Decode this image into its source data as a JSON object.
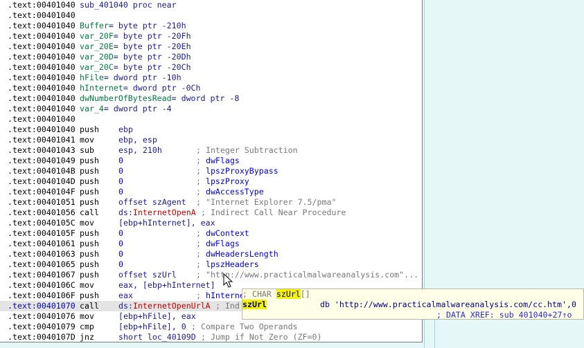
{
  "lines": [
    {
      "addr": ".text:00401040",
      "decl": [
        {
          "t": "sub_401040 proc near",
          "c": "navy"
        }
      ]
    },
    {
      "addr": ".text:00401040",
      "decl": []
    },
    {
      "addr": ".text:00401040",
      "decl": [
        {
          "t": "Buffer",
          "c": "grn"
        },
        {
          "t": "= byte ptr -210h",
          "c": "navy"
        }
      ]
    },
    {
      "addr": ".text:00401040",
      "decl": [
        {
          "t": "var_20F",
          "c": "grn"
        },
        {
          "t": "= byte ptr -20Fh",
          "c": "navy"
        }
      ]
    },
    {
      "addr": ".text:00401040",
      "decl": [
        {
          "t": "var_20E",
          "c": "grn"
        },
        {
          "t": "= byte ptr -20Eh",
          "c": "navy"
        }
      ]
    },
    {
      "addr": ".text:00401040",
      "decl": [
        {
          "t": "var_20D",
          "c": "grn"
        },
        {
          "t": "= byte ptr -20Dh",
          "c": "navy"
        }
      ]
    },
    {
      "addr": ".text:00401040",
      "decl": [
        {
          "t": "var_20C",
          "c": "grn"
        },
        {
          "t": "= byte ptr -20Ch",
          "c": "navy"
        }
      ]
    },
    {
      "addr": ".text:00401040",
      "decl": [
        {
          "t": "hFile",
          "c": "grn"
        },
        {
          "t": "= dword ptr -10h",
          "c": "navy"
        }
      ]
    },
    {
      "addr": ".text:00401040",
      "decl": [
        {
          "t": "hInternet",
          "c": "grn"
        },
        {
          "t": "= dword ptr -0Ch",
          "c": "navy"
        }
      ]
    },
    {
      "addr": ".text:00401040",
      "decl": [
        {
          "t": "dwNumberOfBytesRead",
          "c": "grn"
        },
        {
          "t": "= dword ptr -8",
          "c": "navy"
        }
      ]
    },
    {
      "addr": ".text:00401040",
      "decl": [
        {
          "t": "var_4",
          "c": "grn"
        },
        {
          "t": "= dword ptr -4",
          "c": "navy"
        }
      ]
    },
    {
      "addr": ".text:00401040",
      "decl": []
    },
    {
      "addr": ".text:00401040",
      "mn": "push",
      "op": [
        {
          "t": "ebp",
          "c": "navy"
        }
      ]
    },
    {
      "addr": ".text:00401041",
      "mn": "mov",
      "op": [
        {
          "t": "ebp, esp",
          "c": "navy"
        }
      ]
    },
    {
      "addr": ".text:00401043",
      "mn": "sub",
      "op": [
        {
          "t": "esp, 210h",
          "c": "navy"
        }
      ],
      "cmt": "; Integer Subtraction"
    },
    {
      "addr": ".text:00401049",
      "mn": "push",
      "op": [
        {
          "t": "0",
          "c": "blue"
        }
      ],
      "cmt": "; ",
      "cmtarg": "dwFlags"
    },
    {
      "addr": ".text:0040104B",
      "mn": "push",
      "op": [
        {
          "t": "0",
          "c": "blue"
        }
      ],
      "cmt": "; ",
      "cmtarg": "lpszProxyBypass"
    },
    {
      "addr": ".text:0040104D",
      "mn": "push",
      "op": [
        {
          "t": "0",
          "c": "blue"
        }
      ],
      "cmt": "; ",
      "cmtarg": "lpszProxy"
    },
    {
      "addr": ".text:0040104F",
      "mn": "push",
      "op": [
        {
          "t": "0",
          "c": "blue"
        }
      ],
      "cmt": "; ",
      "cmtarg": "dwAccessType"
    },
    {
      "addr": ".text:00401051",
      "mn": "push",
      "op": [
        {
          "t": "offset szAgent",
          "c": "navy"
        }
      ],
      "cmt": "; \"Internet Explorer 7.5/pma\""
    },
    {
      "addr": ".text:00401056",
      "mn": "call",
      "op": [
        {
          "t": "ds:",
          "c": "navy"
        },
        {
          "t": "InternetOpenA",
          "c": "fn"
        }
      ],
      "cmt": " ; Indirect Call Near Procedure"
    },
    {
      "addr": ".text:0040105C",
      "mn": "mov",
      "op": [
        {
          "t": "[ebp+hInternet], eax",
          "c": "navy"
        }
      ]
    },
    {
      "addr": ".text:0040105F",
      "mn": "push",
      "op": [
        {
          "t": "0",
          "c": "blue"
        }
      ],
      "cmt": "; ",
      "cmtarg": "dwContext"
    },
    {
      "addr": ".text:00401061",
      "mn": "push",
      "op": [
        {
          "t": "0",
          "c": "blue"
        }
      ],
      "cmt": "; ",
      "cmtarg": "dwFlags"
    },
    {
      "addr": ".text:00401063",
      "mn": "push",
      "op": [
        {
          "t": "0",
          "c": "blue"
        }
      ],
      "cmt": "; ",
      "cmtarg": "dwHeadersLength"
    },
    {
      "addr": ".text:00401065",
      "mn": "push",
      "op": [
        {
          "t": "0",
          "c": "blue"
        }
      ],
      "cmt": "; ",
      "cmtarg": "lpszHeaders"
    },
    {
      "addr": ".text:00401067",
      "mn": "push",
      "op": [
        {
          "t": "offset szUrl",
          "c": "navy"
        }
      ],
      "cmt": "; \"http://www.practicalmalwareanalysis.com\"..."
    },
    {
      "addr": ".text:0040106C",
      "mn": "mov",
      "op": [
        {
          "t": "eax, [ebp+hInternet]",
          "c": "navy"
        }
      ]
    },
    {
      "addr": ".text:0040106F",
      "mn": "push",
      "op": [
        {
          "t": "eax",
          "c": "navy"
        }
      ],
      "cmt": "; ",
      "cmtarg": "hInterne"
    },
    {
      "addr": ".text:00401070",
      "mn": "call",
      "op": [
        {
          "t": "ds:",
          "c": "navy"
        },
        {
          "t": "InternetOpenUrlA",
          "c": "fn"
        }
      ],
      "cmt": " ; Ind",
      "current": true
    },
    {
      "addr": ".text:00401076",
      "mn": "mov",
      "op": [
        {
          "t": "[ebp+hFile], eax",
          "c": "navy"
        }
      ]
    },
    {
      "addr": ".text:00401079",
      "mn": "cmp",
      "op": [
        {
          "t": "[ebp+hFile], 0",
          "c": "navy"
        }
      ],
      "cmt": " ; Compare Two Operands"
    },
    {
      "addr": ".text:0040107D",
      "mn": "jnz",
      "op": [
        {
          "t": "short loc_40109D",
          "c": "navy"
        }
      ],
      "cmt": " ; Jump if Not Zero (ZF=0)"
    }
  ],
  "tooltip": {
    "line1_prefix": "; CHAR ",
    "line1_name": "szUrl",
    "line1_suffix": "[]",
    "line2_name": "szUrl",
    "line2_db": "db 'http://www.practicalmalwareanalysis.com/cc.htm',0",
    "line3_xref": "; DATA XREF: sub_401040+27↑o"
  },
  "colors": {
    "function_name": "#c00000",
    "variable": "#007a40",
    "immediate": "#0000cc",
    "comment": "#787878",
    "highlight": "#f3f300"
  },
  "icons": {
    "cursor": "mouse-pointer-icon"
  }
}
